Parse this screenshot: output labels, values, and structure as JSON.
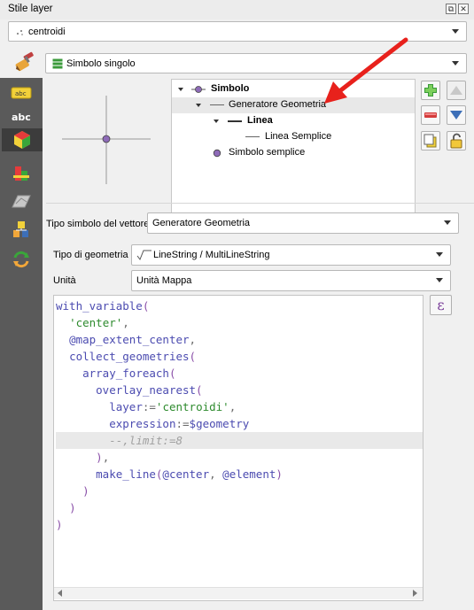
{
  "window": {
    "title": "Stile layer"
  },
  "layer_combo": {
    "value": "centroidi"
  },
  "renderer_combo": {
    "value": "Simbolo singolo"
  },
  "tree": {
    "items": [
      {
        "label": "Simbolo",
        "bold": true
      },
      {
        "label": "Generatore Geometria",
        "bold": false
      },
      {
        "label": "Linea",
        "bold": true
      },
      {
        "label": "Linea Semplice",
        "bold": false
      },
      {
        "label": "Simbolo semplice",
        "bold": false
      }
    ]
  },
  "symbol_type": {
    "label": "Tipo simbolo del vettore",
    "value": "Generatore Geometria"
  },
  "geometry_type": {
    "label": "Tipo di geometria",
    "value": "LineString / MultiLineString"
  },
  "units": {
    "label": "Unità",
    "value": "Unità Mappa"
  },
  "expression_button": {
    "label": "ε"
  },
  "code": {
    "lines": [
      [
        [
          "fn",
          "with_variable"
        ],
        [
          "pun",
          "("
        ]
      ],
      [
        [
          "sp",
          "  "
        ],
        [
          "str",
          "'center'"
        ],
        [
          "sym",
          ","
        ]
      ],
      [
        [
          "sp",
          "  "
        ],
        [
          "var",
          "@map_extent_center"
        ],
        [
          "sym",
          ","
        ]
      ],
      [
        [
          "sp",
          "  "
        ],
        [
          "fn",
          "collect_geometries"
        ],
        [
          "pun",
          "("
        ]
      ],
      [
        [
          "sp",
          "    "
        ],
        [
          "fn",
          "array_foreach"
        ],
        [
          "pun",
          "("
        ]
      ],
      [
        [
          "sp",
          "      "
        ],
        [
          "fn",
          "overlay_nearest"
        ],
        [
          "pun",
          "("
        ]
      ],
      [
        [
          "sp",
          "        "
        ],
        [
          "fn",
          "layer"
        ],
        [
          "sym",
          ":="
        ],
        [
          "str",
          "'centroidi'"
        ],
        [
          "sym",
          ","
        ]
      ],
      [
        [
          "sp",
          "        "
        ],
        [
          "fn",
          "expression"
        ],
        [
          "sym",
          ":="
        ],
        [
          "var",
          "$geometry"
        ]
      ],
      [
        [
          "sp",
          "        "
        ],
        [
          "com",
          "--,limit:=8"
        ]
      ],
      [
        [
          "sp",
          "      "
        ],
        [
          "pun",
          ")"
        ],
        [
          "sym",
          ","
        ]
      ],
      [
        [
          "sp",
          "      "
        ],
        [
          "fn",
          "make_line"
        ],
        [
          "pun",
          "("
        ],
        [
          "var",
          "@center"
        ],
        [
          "sym",
          ", "
        ],
        [
          "var",
          "@element"
        ],
        [
          "pun",
          ")"
        ]
      ],
      [
        [
          "sp",
          "    "
        ],
        [
          "pun",
          ")"
        ]
      ],
      [
        [
          "sp",
          "  "
        ],
        [
          "pun",
          ")"
        ]
      ],
      [
        [
          "pun",
          ")"
        ]
      ]
    ],
    "current_line": 8
  },
  "colors": {
    "accent_red": "#e8211c",
    "add_green": "#3a9a3a",
    "remove_red": "#d43c3c",
    "arrow_blue": "#3d6fb8",
    "code_function": "#4b4bb0",
    "code_string": "#2e8b2e"
  }
}
